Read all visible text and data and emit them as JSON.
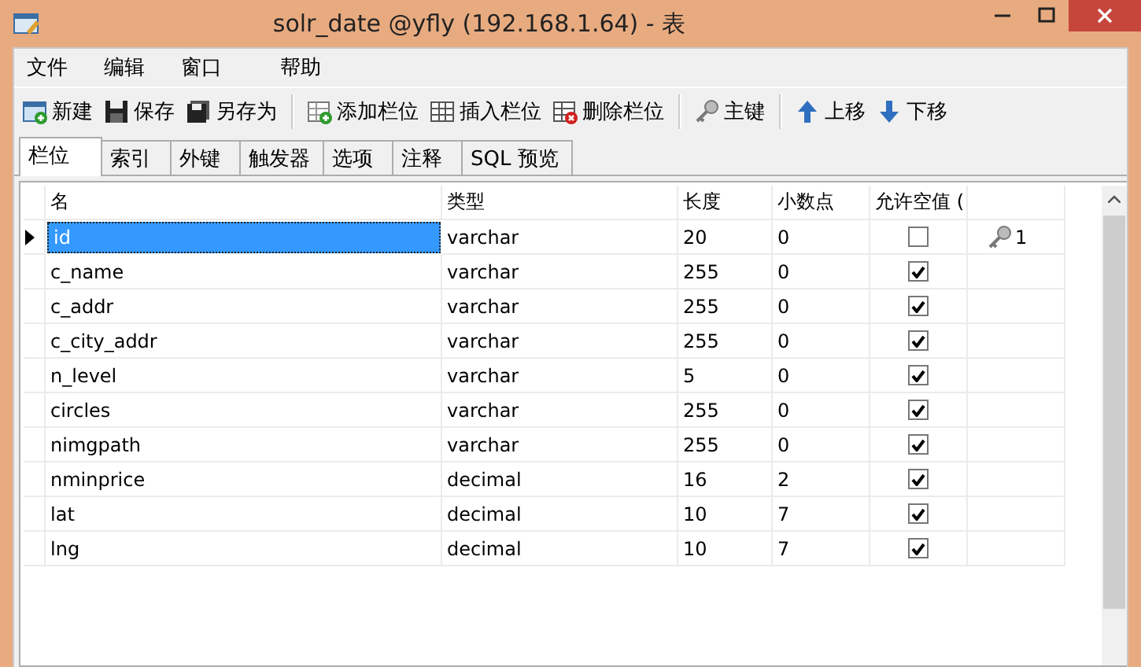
{
  "window": {
    "title": "solr_date @yfly (192.168.1.64) - 表"
  },
  "menu": [
    "文件",
    "编辑",
    "窗口",
    "帮助"
  ],
  "toolbar": [
    [
      "新建",
      "保存",
      "另存为"
    ],
    [
      "添加栏位",
      "插入栏位",
      "删除栏位"
    ],
    [
      "主键"
    ],
    [
      "上移",
      "下移"
    ]
  ],
  "tabs": [
    {
      "label": "栏位",
      "selected": true
    },
    {
      "label": "索引",
      "selected": false
    },
    {
      "label": "外键",
      "selected": false
    },
    {
      "label": "触发器",
      "selected": false
    },
    {
      "label": "选项",
      "selected": false
    },
    {
      "label": "注释",
      "selected": false
    },
    {
      "label": "SQL 预览",
      "selected": false
    }
  ],
  "table": {
    "columns": [
      "名",
      "类型",
      "长度",
      "小数点",
      "允许空值 ("
    ],
    "rows": [
      {
        "name": "id",
        "type": "varchar",
        "length": "20",
        "decimals": "0",
        "nullable": false,
        "key": "1",
        "selected": true
      },
      {
        "name": "c_name",
        "type": "varchar",
        "length": "255",
        "decimals": "0",
        "nullable": true,
        "selected": false
      },
      {
        "name": "c_addr",
        "type": "varchar",
        "length": "255",
        "decimals": "0",
        "nullable": true,
        "selected": false
      },
      {
        "name": "c_city_addr",
        "type": "varchar",
        "length": "255",
        "decimals": "0",
        "nullable": true,
        "selected": false
      },
      {
        "name": "n_level",
        "type": "varchar",
        "length": "5",
        "decimals": "0",
        "nullable": true,
        "selected": false
      },
      {
        "name": "circles",
        "type": "varchar",
        "length": "255",
        "decimals": "0",
        "nullable": true,
        "selected": false
      },
      {
        "name": "nimgpath",
        "type": "varchar",
        "length": "255",
        "decimals": "0",
        "nullable": true,
        "selected": false
      },
      {
        "name": "nminprice",
        "type": "decimal",
        "length": "16",
        "decimals": "2",
        "nullable": true,
        "selected": false
      },
      {
        "name": "lat",
        "type": "decimal",
        "length": "10",
        "decimals": "7",
        "nullable": true,
        "selected": false
      },
      {
        "name": "lng",
        "type": "decimal",
        "length": "10",
        "decimals": "7",
        "nullable": true,
        "selected": false
      }
    ]
  }
}
